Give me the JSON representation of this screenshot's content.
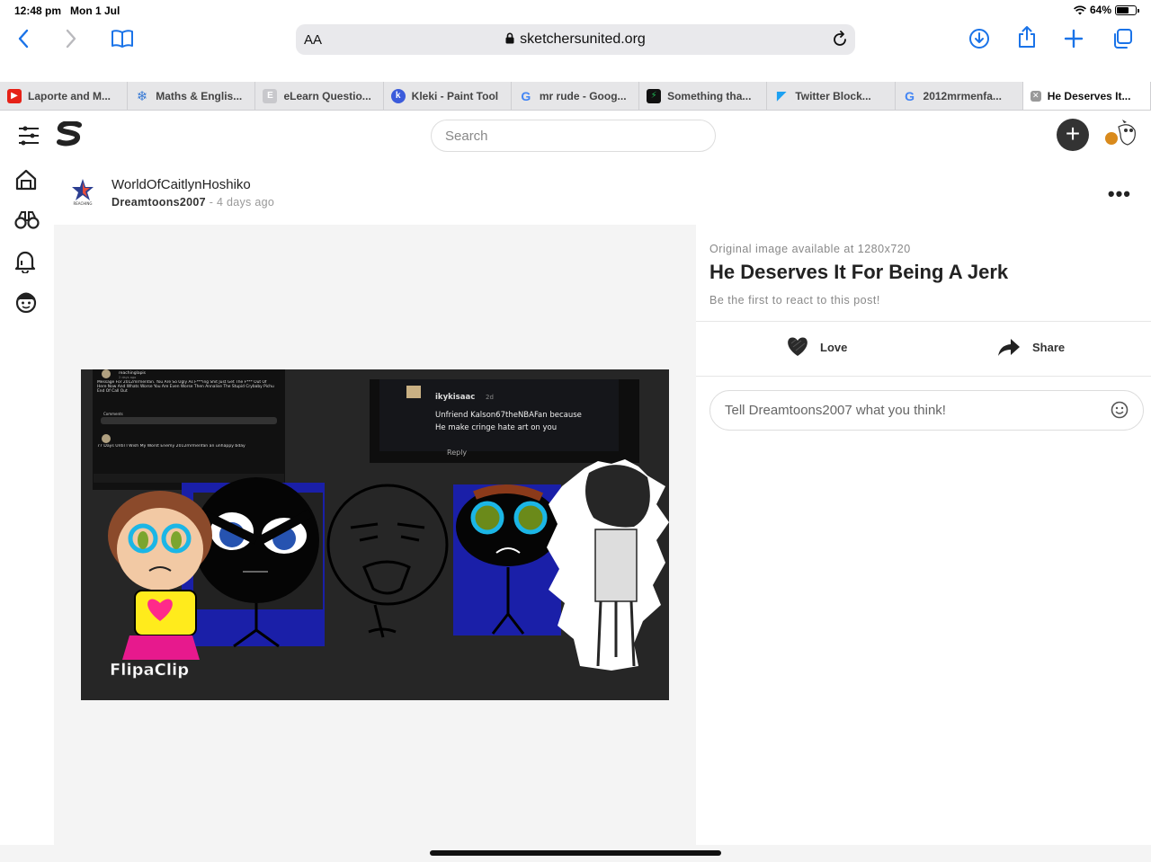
{
  "status": {
    "time": "12:48 pm",
    "date": "Mon 1 Jul",
    "battery": "64%"
  },
  "browser": {
    "aa": "AA",
    "url": "sketchersunited.org",
    "tabs": [
      {
        "label": "Laporte and M...",
        "icon": "youtube-icon",
        "color": "#e62117"
      },
      {
        "label": "Maths & Englis...",
        "icon": "snowflake-icon",
        "color": "#3a7bd5"
      },
      {
        "label": "eLearn Questio...",
        "icon": "elearn-icon",
        "color": "#bbbbbb"
      },
      {
        "label": "Kleki - Paint Tool",
        "icon": "kleki-icon",
        "color": "#3b5bdb"
      },
      {
        "label": "mr rude - Goog...",
        "icon": "google-icon",
        "color": "#4285f4"
      },
      {
        "label": "Something tha...",
        "icon": "bolt-icon",
        "color": "#1db954"
      },
      {
        "label": "Twitter Block...",
        "icon": "bird-icon",
        "color": "#1da1f2"
      },
      {
        "label": "2012mrmenfa...",
        "icon": "google-icon",
        "color": "#4285f4"
      },
      {
        "label": "He Deserves It...",
        "icon": "close-tab-icon",
        "color": "#888888"
      }
    ]
  },
  "site": {
    "search_placeholder": "Search"
  },
  "post": {
    "title": "WorldOfCaitlynHoshiko",
    "author": "Dreamtoons2007",
    "time": "4 days ago",
    "separator": " - ",
    "artwork": {
      "comment1_user": "reachinglapis",
      "comment1_time": "2 days ago",
      "comment1_text": "Message For 2012mrmenfan. You Are So Ugly As F***ing Shit Just Get The F*** Out Of Here Now And Whats Worse You Are Even Worse Then Annalise The Stupid Crybaby Pichu End Of Call Out",
      "comment2_text": "77 Days Until I Wish My Worst Enemy 2012mrmenfan an unhappy bday",
      "comments_label": "Comments",
      "reply_user": "ikykisaac",
      "reply_time": "2d",
      "reply_line1": "Unfriend Kalson67theNBAFan because",
      "reply_line2": "He make cringe hate art on you",
      "reply_label": "Reply",
      "watermark": "FlipaClip"
    }
  },
  "panel": {
    "available": "Original image available at 1280x720",
    "title": "He Deserves It For Being A Jerk",
    "react": "Be the first to react to this post!",
    "love": "Love",
    "share": "Share",
    "comment_placeholder": "Tell Dreamtoons2007 what you think!"
  }
}
